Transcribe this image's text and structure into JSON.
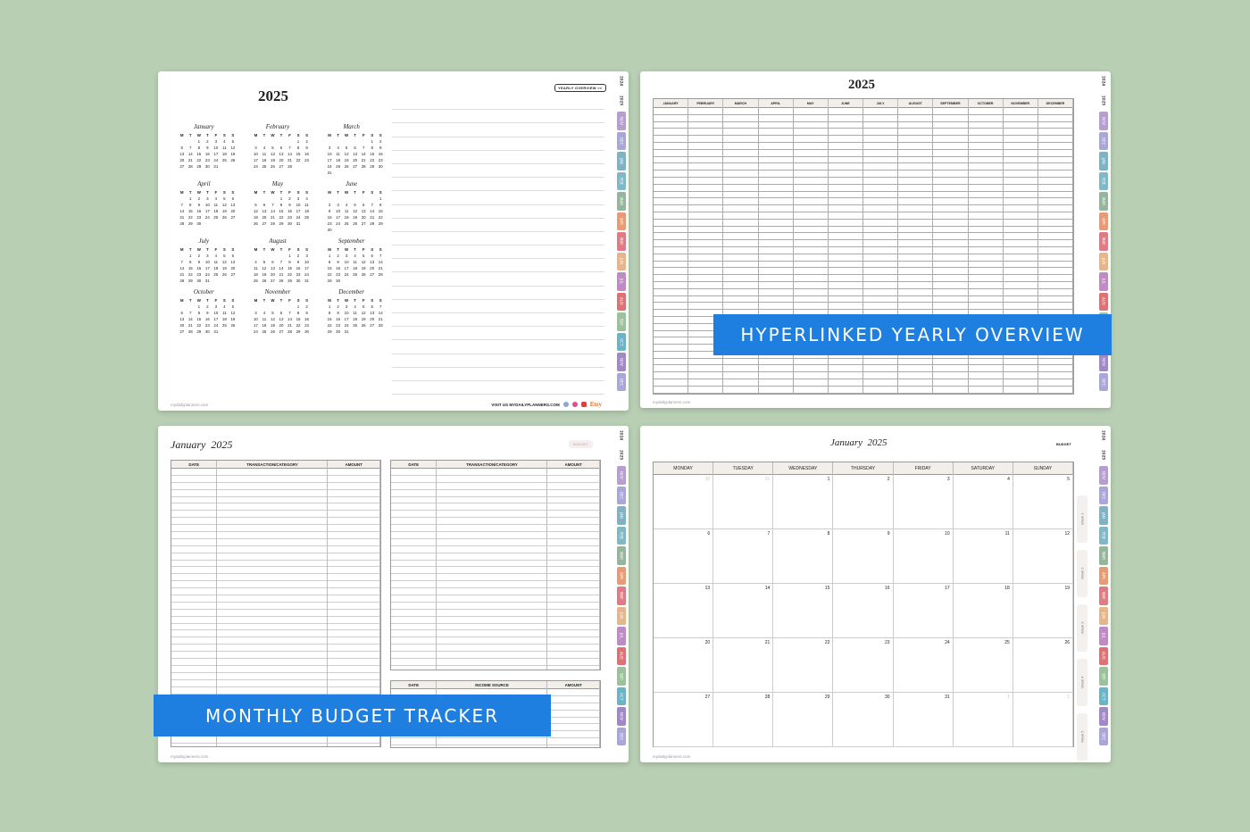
{
  "tab_colors": [
    "#b79ed0",
    "#a9a6d9",
    "#7fb2c3",
    "#7fb8c6",
    "#95b59c",
    "#e79a73",
    "#de7b84",
    "#e8b58a",
    "#c08bc5",
    "#de7174",
    "#9cc29c",
    "#6bb3c6",
    "#a188c6",
    "#a9a6d9"
  ],
  "tabs_p1": [
    "2024",
    "2025",
    "NOV",
    "DEC",
    "JAN",
    "FEB",
    "MAR",
    "APR",
    "MAY",
    "JUN",
    "JUL",
    "AUG",
    "SEP",
    "OCT",
    "NOV",
    "DEC"
  ],
  "tabs_p4": [
    "2024",
    "2025",
    "NOV",
    "DEC",
    "JAN",
    "FEB",
    "MAR",
    "APR",
    "MAY",
    "JUN",
    "JUL",
    "AUG",
    "SEP",
    "OCT",
    "NOV",
    "DEC"
  ],
  "footer": "mydailyplanners.com",
  "yearly": {
    "year": "2025",
    "chip": "YEARLY OVERVIEW >>",
    "visit": "VISIT US MYDAILYPLANNERS.COM",
    "etsy": "Etsy",
    "weekday_heads": [
      "M",
      "T",
      "W",
      "T",
      "F",
      "S",
      "S"
    ],
    "months": [
      {
        "name": "January",
        "offset": 2,
        "days": 31
      },
      {
        "name": "February",
        "offset": 5,
        "days": 28
      },
      {
        "name": "March",
        "offset": 5,
        "days": 31
      },
      {
        "name": "April",
        "offset": 1,
        "days": 30
      },
      {
        "name": "May",
        "offset": 3,
        "days": 31
      },
      {
        "name": "June",
        "offset": 6,
        "days": 30
      },
      {
        "name": "July",
        "offset": 1,
        "days": 31
      },
      {
        "name": "August",
        "offset": 4,
        "days": 31
      },
      {
        "name": "September",
        "offset": 0,
        "days": 30
      },
      {
        "name": "October",
        "offset": 2,
        "days": 31
      },
      {
        "name": "November",
        "offset": 5,
        "days": 30
      },
      {
        "name": "December",
        "offset": 0,
        "days": 31
      }
    ]
  },
  "overview": {
    "year": "2025",
    "months": [
      "JANUARY",
      "FEBRUARY",
      "MARCH",
      "APRIL",
      "MAY",
      "JUNE",
      "JULY",
      "AUGUST",
      "SEPTEMBER",
      "OCTOBER",
      "NOVEMBER",
      "DECEMBER"
    ],
    "banner": "HYPERLINKED YEARLY OVERVIEW"
  },
  "budget": {
    "title": "January",
    "year": "2025",
    "badge": "BUDGET",
    "cols": [
      "DATE",
      "TRANSACTION/CATEGORY",
      "AMOUNT"
    ],
    "income_cols": [
      "DATE",
      "INCOME SOURCE",
      "AMOUNT"
    ],
    "banner": "MONTHLY BUDGET TRACKER"
  },
  "calendar": {
    "title": "January",
    "year": "2025",
    "badge": "BUDGET",
    "days": [
      "MONDAY",
      "TUESDAY",
      "WEDNESDAY",
      "THURSDAY",
      "FRIDAY",
      "SATURDAY",
      "SUNDAY"
    ],
    "cells": [
      "30",
      "31",
      "1",
      "2",
      "3",
      "4",
      "5",
      "6",
      "7",
      "8",
      "9",
      "10",
      "11",
      "12",
      "13",
      "14",
      "15",
      "16",
      "17",
      "18",
      "19",
      "20",
      "21",
      "22",
      "23",
      "24",
      "25",
      "26",
      "27",
      "28",
      "29",
      "30",
      "31",
      "1",
      "2"
    ],
    "weeks": [
      "Week 1",
      "Week 2",
      "Week 3",
      "Week 4",
      "Week 5"
    ]
  }
}
